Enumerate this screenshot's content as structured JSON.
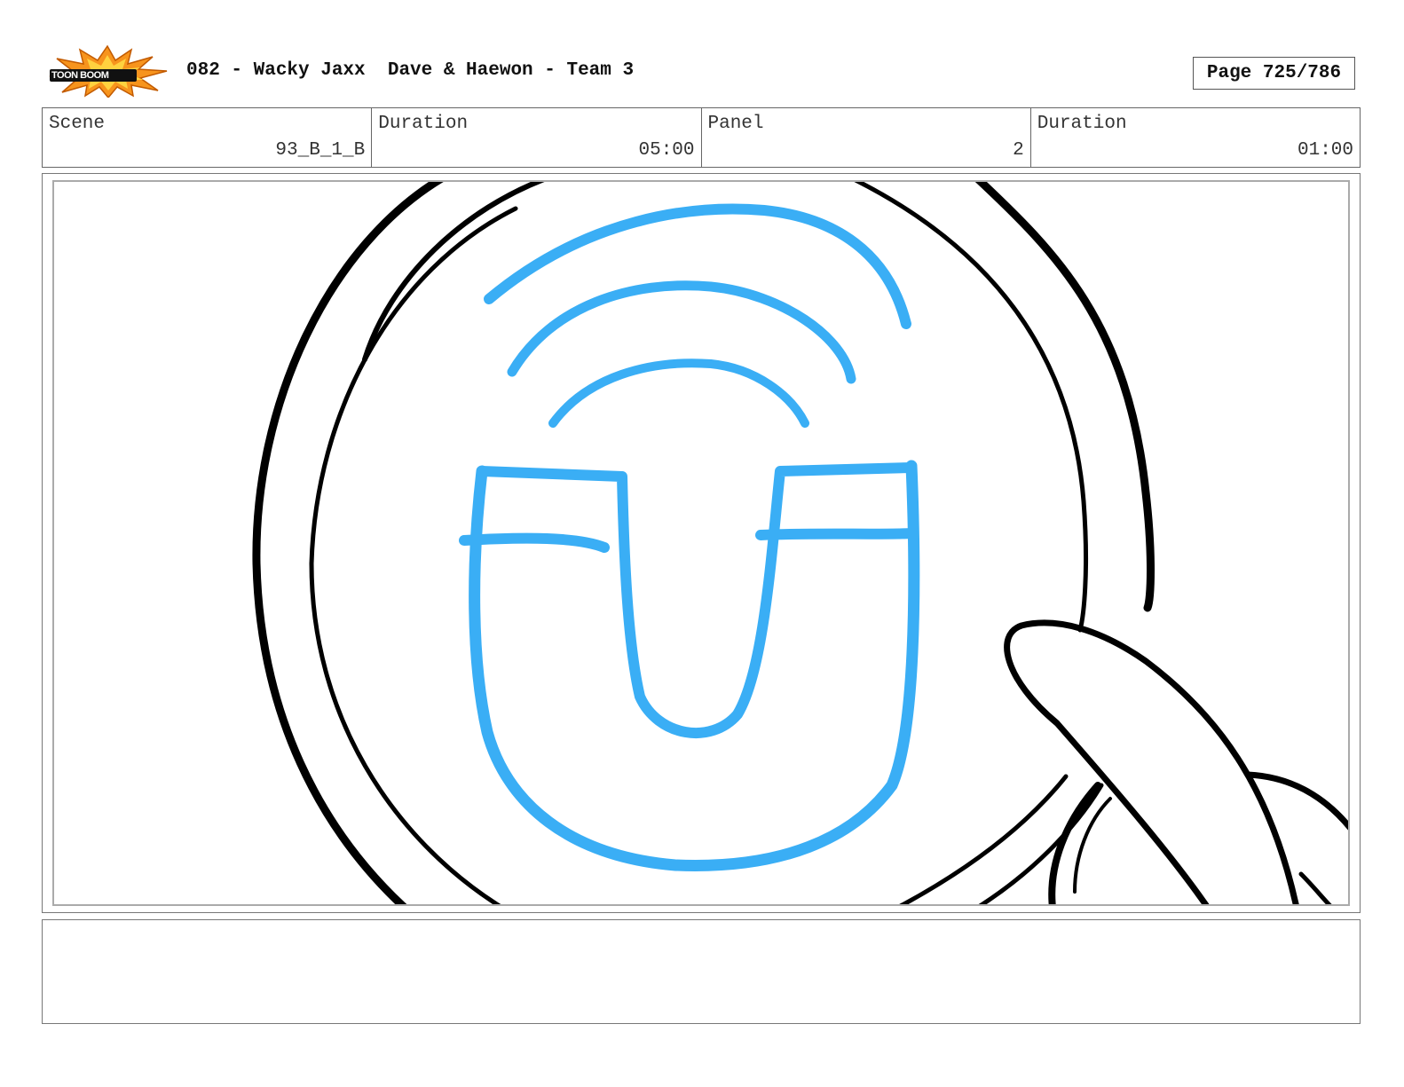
{
  "header": {
    "logo_text": "TOON BOOM",
    "title": "082 - Wacky Jaxx  Dave & Haewon - Team 3",
    "page_label": "Page 725/786"
  },
  "info": [
    {
      "label": "Scene",
      "value": "93_B_1_B"
    },
    {
      "label": "Duration",
      "value": "05:00"
    },
    {
      "label": "Panel",
      "value": "2"
    },
    {
      "label": "Duration",
      "value": "01:00"
    }
  ],
  "drawing": {
    "subject": "magnifier-lens-with-magnet-icon",
    "line_color": "#000000",
    "accent_color": "#3aaef5"
  },
  "notes": ""
}
